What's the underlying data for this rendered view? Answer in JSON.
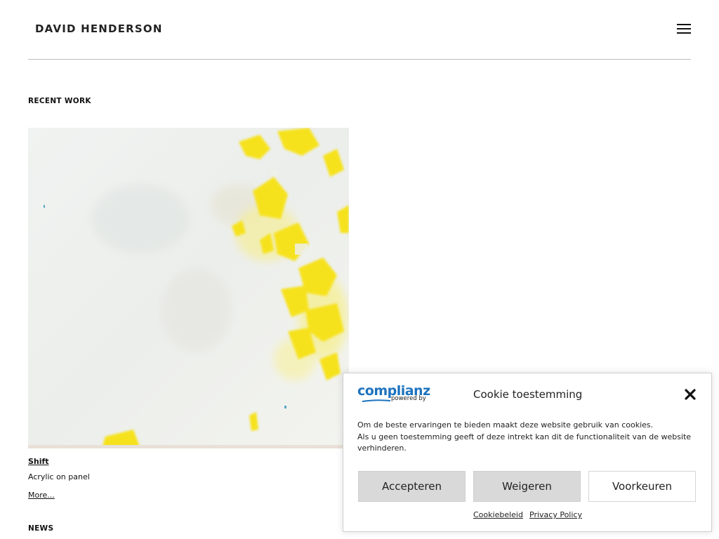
{
  "header": {
    "site_title": "DAVID HENDERSON",
    "menu_icon": "hamburger-menu-icon"
  },
  "recent_work": {
    "heading": "RECENT WORK",
    "items": [
      {
        "title": "Shift",
        "medium": "Acrylic on panel",
        "more_label": "More..."
      }
    ]
  },
  "news": {
    "heading": "NEWS"
  },
  "cookie_banner": {
    "logo_text": "complianz",
    "logo_subtext": "powered by",
    "title": "Cookie toestemming",
    "close_icon": "close-icon",
    "message_line1": "Om de beste ervaringen te bieden maakt deze website gebruik van cookies.",
    "message_line2": "Als u geen toestemming geeft of deze intrekt kan dit de functionaliteit van de website verhinderen.",
    "accept_label": "Accepteren",
    "deny_label": "Weigeren",
    "preferences_label": "Voorkeuren",
    "cookie_policy_label": "Cookiebeleid",
    "privacy_policy_label": "Privacy Policy",
    "brand_color": "#1e73be"
  }
}
